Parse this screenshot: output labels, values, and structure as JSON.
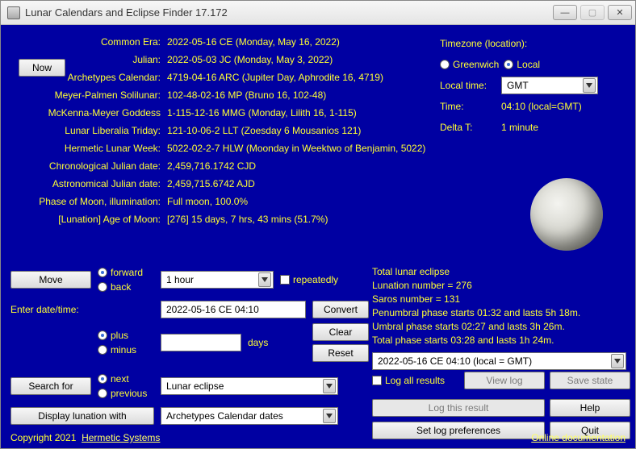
{
  "window": {
    "title": "Lunar Calendars and Eclipse Finder 17.172",
    "min": "—",
    "max": "▢",
    "close": "✕"
  },
  "now_button": "Now",
  "rows": {
    "labels": [
      "Common Era:",
      "Julian:",
      "Archetypes Calendar:",
      "Meyer-Palmen Solilunar:",
      "McKenna-Meyer Goddess",
      "Lunar Liberalia Triday:",
      "Hermetic Lunar Week:",
      "Chronological Julian date:",
      "Astronomical Julian date:",
      "Phase of Moon, illumination:",
      "[Lunation] Age of Moon:"
    ],
    "values": [
      "2022-05-16 CE (Monday, May 16, 2022)",
      "2022-05-03 JC (Monday, May 3, 2022)",
      "4719-04-16 ARC (Jupiter Day, Aphrodite 16,  4719)",
      "102-48-02-16 MP (Bruno 16, 102-48)",
      "1-115-12-16 MMG (Monday, Lilith 16, 1-115)",
      "121-10-06-2 LLT (Zoesday 6 Mousanios 121)",
      "5022-02-2-7 HLW (Moonday in Weektwo of Benjamin, 5022)",
      "2,459,716.1742 CJD",
      "2,459,715.6742 AJD",
      "Full moon, 100.0%",
      "[276] 15 days, 7 hrs, 43 mins (51.7%)"
    ]
  },
  "side": {
    "timezone_label": "Timezone (location):",
    "tz_greenwich": "Greenwich",
    "tz_local": "Local",
    "localtime_label": "Local time:",
    "localtime_value": "GMT",
    "time_label": "Time:",
    "time_value": "04:10 (local=GMT)",
    "deltat_label": "Delta T:",
    "deltat_value": "1 minute"
  },
  "move": {
    "button": "Move",
    "forward": "forward",
    "back": "back",
    "step": "1 hour",
    "repeatedly": "repeatedly"
  },
  "dt": {
    "enter_label": "Enter date/time:",
    "value": "2022-05-16 CE 04:10",
    "convert": "Convert",
    "plus": "plus",
    "minus": "minus",
    "days_input": "",
    "days_label": "days",
    "clear": "Clear",
    "reset": "Reset"
  },
  "search": {
    "button": "Search for",
    "next": "next",
    "previous": "previous",
    "target": "Lunar eclipse"
  },
  "display": {
    "button": "Display lunation with",
    "calendar": "Archetypes Calendar dates"
  },
  "eclipse": {
    "l1": "Total lunar eclipse",
    "l2": "Lunation number = 276",
    "l3": "Saros number = 131",
    "l4": "Penumbral phase starts 01:32 and lasts 5h 18m.",
    "l5": "Umbral phase starts 02:27 and lasts 3h 26m.",
    "l6": "Total phase starts 03:28 and lasts 1h 24m.",
    "history": "2022-05-16 CE 04:10 (local = GMT)"
  },
  "log": {
    "logall": "Log all results",
    "viewlog": "View log",
    "savestate": "Save state",
    "logthis": "Log this result",
    "help": "Help",
    "setprefs": "Set log preferences",
    "quit": "Quit"
  },
  "footer": {
    "copyright": "Copyright 2021 ",
    "hermetic": "Hermetic Systems",
    "online": "Online documentation"
  }
}
